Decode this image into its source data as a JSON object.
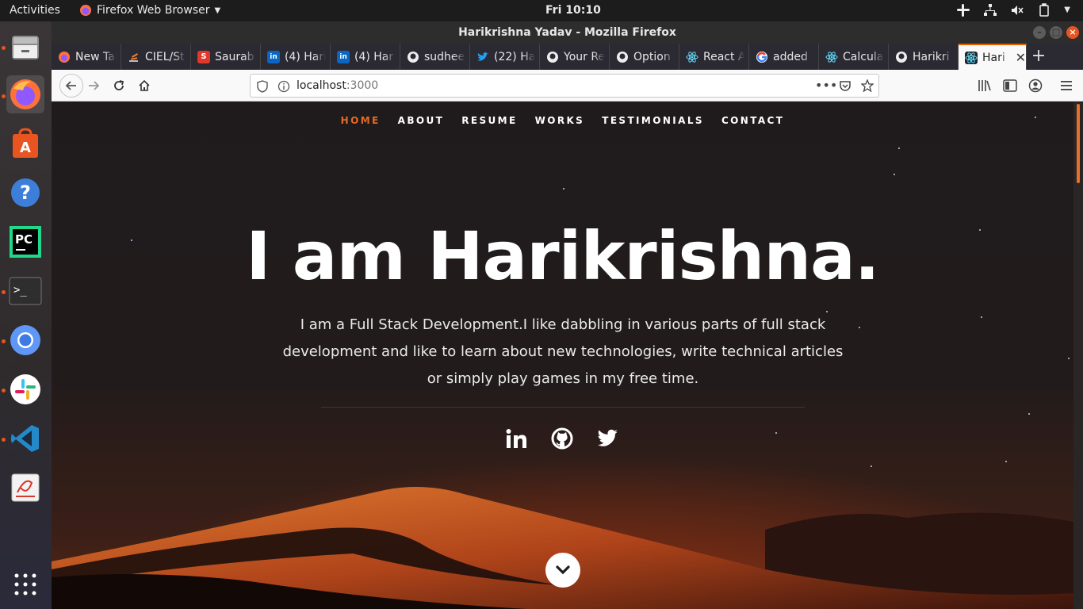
{
  "topbar": {
    "activities": "Activities",
    "app_name": "Firefox Web Browser",
    "clock": "Fri 10:10"
  },
  "window": {
    "title": "Harikrishna Yadav - Mozilla Firefox"
  },
  "tabs": [
    {
      "label": "New Tab",
      "icon": "firefox-icon"
    },
    {
      "label": "CIEL/St",
      "icon": "stackoverflow-icon"
    },
    {
      "label": "Saurab",
      "icon": "s-brand-icon"
    },
    {
      "label": "(4) Hari",
      "icon": "linkedin-icon"
    },
    {
      "label": "(4) Har",
      "icon": "linkedin-icon"
    },
    {
      "label": "sudhee",
      "icon": "github-icon"
    },
    {
      "label": "(22) Ha",
      "icon": "twitter-icon"
    },
    {
      "label": "Your Re",
      "icon": "github-icon"
    },
    {
      "label": "Option",
      "icon": "github-icon"
    },
    {
      "label": "React A",
      "icon": "react-icon"
    },
    {
      "label": "added",
      "icon": "google-icon"
    },
    {
      "label": "Calcula",
      "icon": "react-icon"
    },
    {
      "label": "Harikri",
      "icon": "github-icon"
    },
    {
      "label": "Hari",
      "icon": "react-icon",
      "active": true
    }
  ],
  "urlbar": {
    "host": "localhost",
    "port": ":3000"
  },
  "site": {
    "nav": [
      "HOME",
      "ABOUT",
      "RESUME",
      "WORKS",
      "TESTIMONIALS",
      "CONTACT"
    ],
    "headline": "I am Harikrishna.",
    "intro_lines": [
      "I am a Full Stack Development.I like dabbling in various parts of full stack",
      "development and like to learn about new technologies, write technical articles",
      "or simply play games in my free time."
    ],
    "social": [
      "linkedin-icon",
      "github-icon",
      "twitter-icon"
    ],
    "accent": "#e36a24"
  },
  "dock": [
    "files-icon",
    "firefox-icon",
    "software-center-icon",
    "help-icon",
    "pycharm-icon",
    "terminal-icon",
    "chromium-icon",
    "slack-icon",
    "vscode-icon",
    "document-viewer-icon",
    "app-grid-icon"
  ]
}
